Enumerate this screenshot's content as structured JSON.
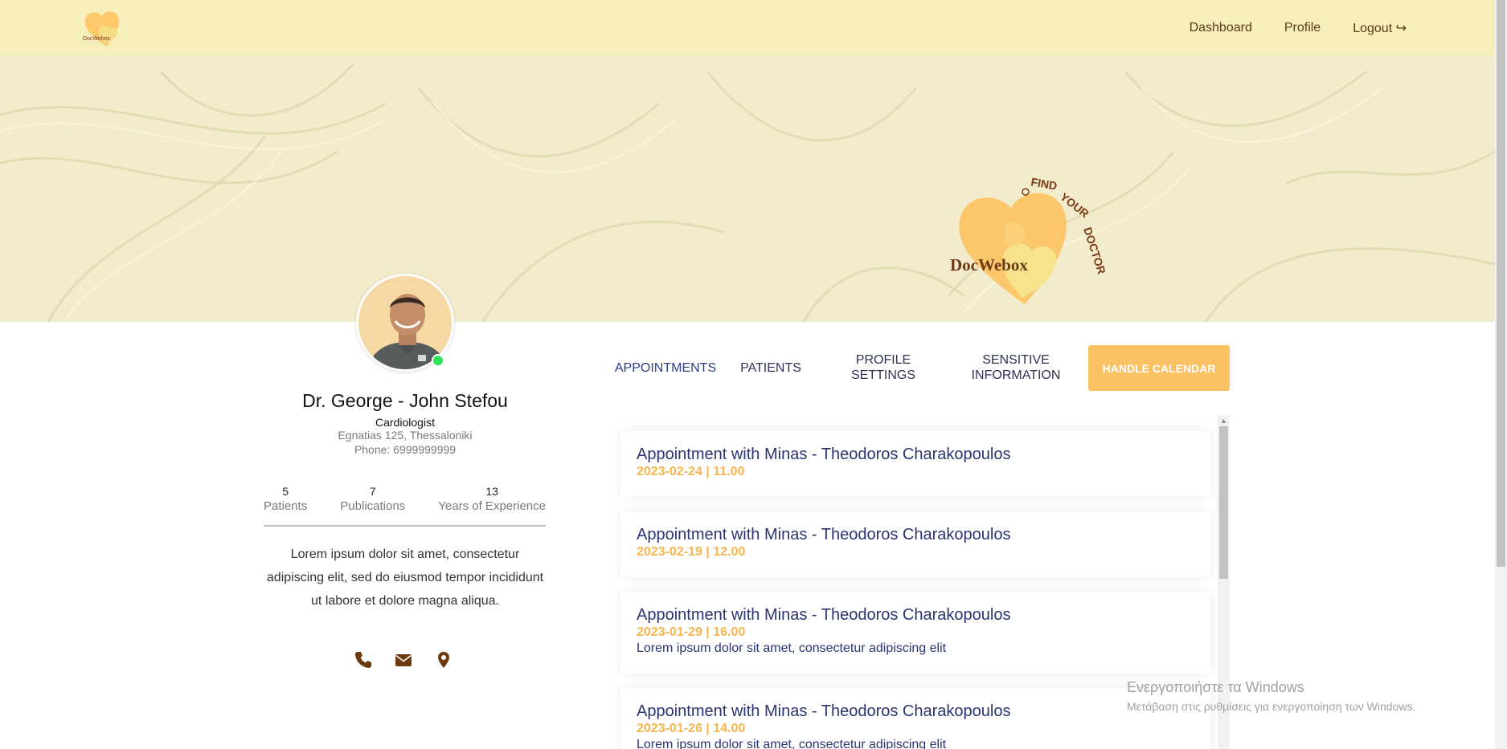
{
  "nav": {
    "links": [
      "Dashboard",
      "Profile",
      "Logout ↪"
    ]
  },
  "brand": {
    "name": "DocWebox",
    "tagline": "FIND YOUR DOCTOR"
  },
  "doctor": {
    "name": "Dr. George - John Stefou",
    "specialty": "Cardiologist",
    "address": "Egnatias 125, Thessaloniki",
    "phone": "Phone: 6999999999",
    "stats": [
      {
        "value": "5",
        "label": "Patients"
      },
      {
        "value": "7",
        "label": "Publications"
      },
      {
        "value": "13",
        "label": "Years of Experience"
      }
    ],
    "bio": "Lorem ipsum dolor sit amet, consectetur adipiscing elit, sed do eiusmod tempor incididunt ut labore et dolore magna aliqua.",
    "contact_icons": [
      "phone-icon",
      "envelope-icon",
      "map-marker-icon"
    ],
    "online": true
  },
  "tabs": {
    "appointments": "APPOINTMENTS",
    "patients": "PATIENTS",
    "profile_settings": "PROFILE SETTINGS",
    "sensitive_information": "SENSITIVE INFORMATION",
    "handle_calendar": "HANDLE CALENDAR"
  },
  "appointments": [
    {
      "title": "Appointment with Minas - Theodoros Charakopoulos",
      "date": "2023-02-24 | 11.00",
      "desc": ""
    },
    {
      "title": "Appointment with Minas - Theodoros Charakopoulos",
      "date": "2023-02-19 | 12.00",
      "desc": ""
    },
    {
      "title": "Appointment with Minas - Theodoros Charakopoulos",
      "date": "2023-01-29 | 16.00",
      "desc": "Lorem ipsum dolor sit amet, consectetur adipiscing elit"
    },
    {
      "title": "Appointment with Minas - Theodoros Charakopoulos",
      "date": "2023-01-26 | 14.00",
      "desc": "Lorem ipsum dolor sit amet, consectetur adipiscing elit"
    }
  ],
  "windows_watermark": {
    "line1": "Ενεργοποιήστε τα Windows",
    "line2": "Μετάβαση στις ρυθμίσεις για ενεργοποίηση των Windows."
  },
  "colors": {
    "nav_bg": "#f6efbb",
    "accent": "#fbc264",
    "title": "#2b3472",
    "date": "#f8b54b",
    "icon": "#6b3a0f"
  }
}
